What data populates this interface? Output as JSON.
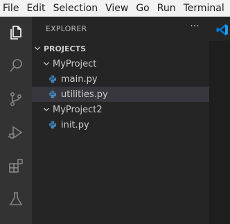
{
  "menubar": {
    "items": [
      "File",
      "Edit",
      "Selection",
      "View",
      "Go",
      "Run",
      "Terminal"
    ]
  },
  "activitybar": {
    "icons": [
      "explorer-icon",
      "search-icon",
      "source-control-icon",
      "run-debug-icon",
      "extensions-icon",
      "testing-icon"
    ]
  },
  "sidebar": {
    "title": "EXPLORER",
    "more": "···",
    "section": "PROJECTS",
    "folders": [
      {
        "name": "MyProject",
        "files": [
          "main.py",
          "utilities.py"
        ]
      },
      {
        "name": "MyProject2",
        "files": [
          "init.py"
        ]
      }
    ],
    "selected_file": "utilities.py"
  },
  "colors": {
    "menubar_bg": "#f2f2f2",
    "activitybar_bg": "#333333",
    "sidebar_bg": "#252526",
    "editor_bg": "#1e1e1e",
    "selection_bg": "#37373d",
    "vscode_blue": "#0078d4",
    "python_blue": "#3572a5"
  }
}
